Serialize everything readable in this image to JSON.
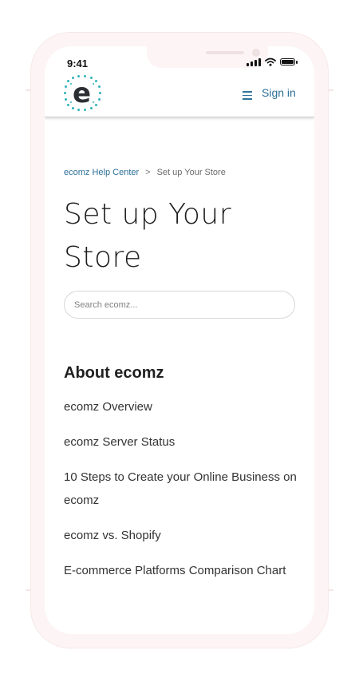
{
  "status_bar": {
    "time": "9:41"
  },
  "header": {
    "logo_letter": "e",
    "menu_icon": "hamburger-menu-icon",
    "sign_in_label": "Sign in"
  },
  "breadcrumb": {
    "home_label": "ecomz Help Center",
    "separator": ">",
    "current_label": "Set up Your Store"
  },
  "page": {
    "title": "Set up Your Store"
  },
  "search": {
    "placeholder": "Search ecomz..."
  },
  "section": {
    "title": "About ecomz",
    "articles": [
      "ecomz Overview",
      "ecomz Server Status",
      "10 Steps to Create your Online Business on ecomz",
      "ecomz vs. Shopify",
      "E-commerce Platforms Comparison Chart"
    ]
  },
  "colors": {
    "accent_teal": "#31b5b9",
    "link_blue": "#2c6f96"
  }
}
